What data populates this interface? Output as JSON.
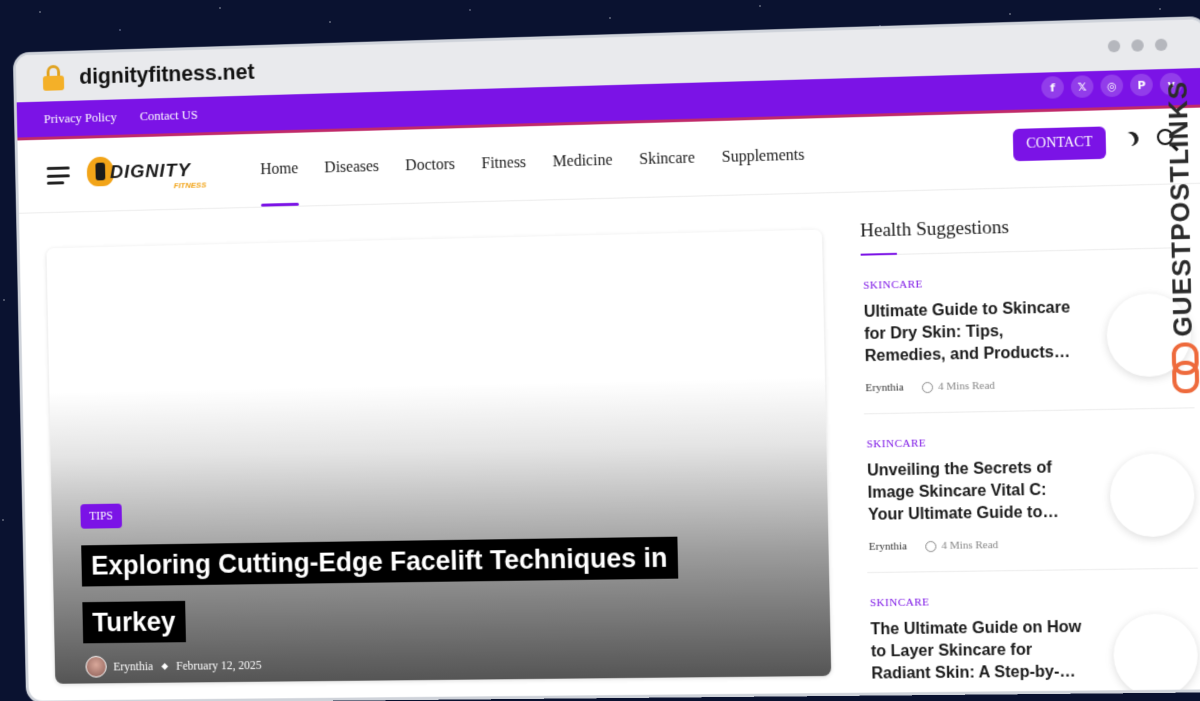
{
  "browser": {
    "url": "dignityfitness.net"
  },
  "topbar": {
    "links": [
      "Privacy Policy",
      "Contact US"
    ],
    "social_icons": [
      "facebook-icon",
      "x-icon",
      "instagram-icon",
      "pinterest-icon",
      "vimeo-icon"
    ]
  },
  "nav": {
    "logo_text": "DIGNITY",
    "logo_sub": "FITNESS",
    "items": [
      "Home",
      "Diseases",
      "Doctors",
      "Fitness",
      "Medicine",
      "Skincare",
      "Supplements"
    ],
    "active": "Home",
    "contact_label": "CONTACT"
  },
  "hero": {
    "badge": "TIPS",
    "title": "Exploring Cutting-Edge Facelift Techniques in Turkey",
    "author": "Erynthia",
    "date": "February 12, 2025"
  },
  "sidebar": {
    "title": "Health Suggestions",
    "posts": [
      {
        "category": "SKINCARE",
        "title": "Ultimate Guide to Skincare for Dry Skin: Tips, Remedies, and Products…",
        "author": "Erynthia",
        "read": "4 Mins Read"
      },
      {
        "category": "SKINCARE",
        "title": "Unveiling the Secrets of Image Skincare Vital C: Your Ultimate Guide to…",
        "author": "Erynthia",
        "read": "4 Mins Read"
      },
      {
        "category": "SKINCARE",
        "title": "The Ultimate Guide on How to Layer Skincare for Radiant Skin: A Step-by-…",
        "author": "",
        "read": ""
      }
    ]
  },
  "watermark": "GUESTPOSTLINKS",
  "colors": {
    "accent": "#7b13e6",
    "topbar": "#7b13e6",
    "logo_orange": "#f2a418",
    "watermark_link": "#ee6a3c"
  }
}
